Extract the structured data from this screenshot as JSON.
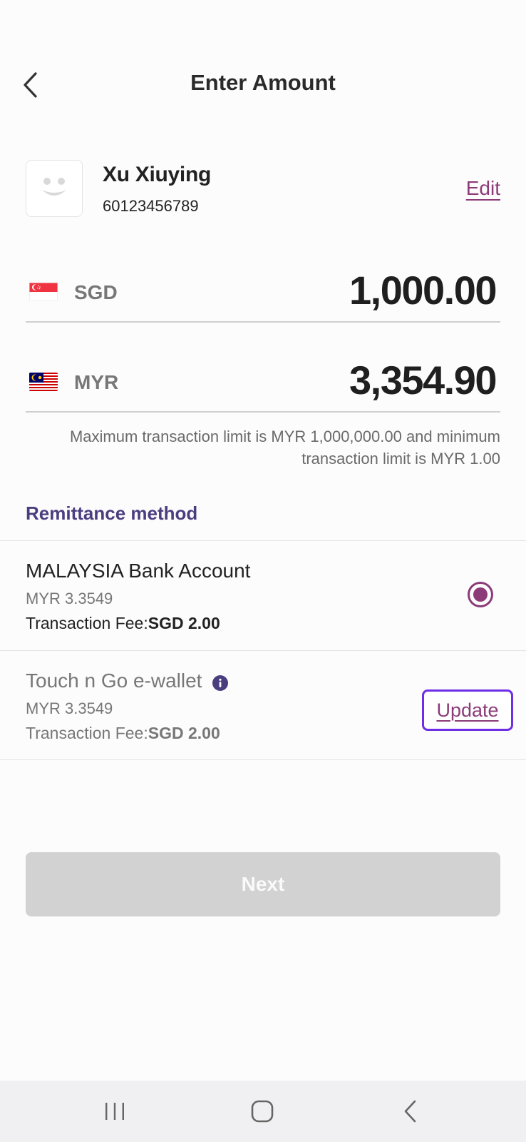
{
  "header": {
    "title": "Enter Amount"
  },
  "recipient": {
    "name": "Xu Xiuying",
    "phone": "60123456789",
    "edit_label": "Edit"
  },
  "send": {
    "currency": "SGD",
    "amount": "1,000.00",
    "flag_icon": "singapore-flag-icon"
  },
  "receive": {
    "currency": "MYR",
    "amount": "3,354.90",
    "flag_icon": "malaysia-flag-icon"
  },
  "limit_text": "Maximum transaction limit is MYR 1,000,000.00 and minimum transaction limit is MYR 1.00",
  "remittance": {
    "title": "Remittance method",
    "methods": [
      {
        "name": "MALAYSIA Bank Account",
        "rate": "MYR 3.3549",
        "fee_label": "Transaction Fee:",
        "fee_value": "SGD 2.00",
        "selected": true
      },
      {
        "name": "Touch n Go e-wallet",
        "rate": "MYR 3.3549",
        "fee_label": "Transaction Fee:",
        "fee_value": "SGD 2.00",
        "action_label": "Update"
      }
    ]
  },
  "next_label": "Next",
  "colors": {
    "accent": "#8c3b78",
    "section": "#4b3e7f",
    "focus": "#6e2ee6",
    "disabled": "#d2d2d2"
  }
}
